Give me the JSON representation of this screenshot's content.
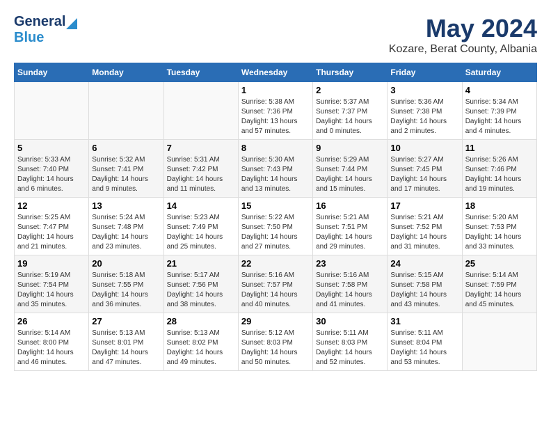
{
  "header": {
    "logo_general": "General",
    "logo_blue": "Blue",
    "month_title": "May 2024",
    "location": "Kozare, Berat County, Albania"
  },
  "days_of_week": [
    "Sunday",
    "Monday",
    "Tuesday",
    "Wednesday",
    "Thursday",
    "Friday",
    "Saturday"
  ],
  "weeks": [
    [
      {
        "date": "",
        "sunrise": "",
        "sunset": "",
        "daylight": ""
      },
      {
        "date": "",
        "sunrise": "",
        "sunset": "",
        "daylight": ""
      },
      {
        "date": "",
        "sunrise": "",
        "sunset": "",
        "daylight": ""
      },
      {
        "date": "1",
        "sunrise": "Sunrise: 5:38 AM",
        "sunset": "Sunset: 7:36 PM",
        "daylight": "Daylight: 13 hours and 57 minutes."
      },
      {
        "date": "2",
        "sunrise": "Sunrise: 5:37 AM",
        "sunset": "Sunset: 7:37 PM",
        "daylight": "Daylight: 14 hours and 0 minutes."
      },
      {
        "date": "3",
        "sunrise": "Sunrise: 5:36 AM",
        "sunset": "Sunset: 7:38 PM",
        "daylight": "Daylight: 14 hours and 2 minutes."
      },
      {
        "date": "4",
        "sunrise": "Sunrise: 5:34 AM",
        "sunset": "Sunset: 7:39 PM",
        "daylight": "Daylight: 14 hours and 4 minutes."
      }
    ],
    [
      {
        "date": "5",
        "sunrise": "Sunrise: 5:33 AM",
        "sunset": "Sunset: 7:40 PM",
        "daylight": "Daylight: 14 hours and 6 minutes."
      },
      {
        "date": "6",
        "sunrise": "Sunrise: 5:32 AM",
        "sunset": "Sunset: 7:41 PM",
        "daylight": "Daylight: 14 hours and 9 minutes."
      },
      {
        "date": "7",
        "sunrise": "Sunrise: 5:31 AM",
        "sunset": "Sunset: 7:42 PM",
        "daylight": "Daylight: 14 hours and 11 minutes."
      },
      {
        "date": "8",
        "sunrise": "Sunrise: 5:30 AM",
        "sunset": "Sunset: 7:43 PM",
        "daylight": "Daylight: 14 hours and 13 minutes."
      },
      {
        "date": "9",
        "sunrise": "Sunrise: 5:29 AM",
        "sunset": "Sunset: 7:44 PM",
        "daylight": "Daylight: 14 hours and 15 minutes."
      },
      {
        "date": "10",
        "sunrise": "Sunrise: 5:27 AM",
        "sunset": "Sunset: 7:45 PM",
        "daylight": "Daylight: 14 hours and 17 minutes."
      },
      {
        "date": "11",
        "sunrise": "Sunrise: 5:26 AM",
        "sunset": "Sunset: 7:46 PM",
        "daylight": "Daylight: 14 hours and 19 minutes."
      }
    ],
    [
      {
        "date": "12",
        "sunrise": "Sunrise: 5:25 AM",
        "sunset": "Sunset: 7:47 PM",
        "daylight": "Daylight: 14 hours and 21 minutes."
      },
      {
        "date": "13",
        "sunrise": "Sunrise: 5:24 AM",
        "sunset": "Sunset: 7:48 PM",
        "daylight": "Daylight: 14 hours and 23 minutes."
      },
      {
        "date": "14",
        "sunrise": "Sunrise: 5:23 AM",
        "sunset": "Sunset: 7:49 PM",
        "daylight": "Daylight: 14 hours and 25 minutes."
      },
      {
        "date": "15",
        "sunrise": "Sunrise: 5:22 AM",
        "sunset": "Sunset: 7:50 PM",
        "daylight": "Daylight: 14 hours and 27 minutes."
      },
      {
        "date": "16",
        "sunrise": "Sunrise: 5:21 AM",
        "sunset": "Sunset: 7:51 PM",
        "daylight": "Daylight: 14 hours and 29 minutes."
      },
      {
        "date": "17",
        "sunrise": "Sunrise: 5:21 AM",
        "sunset": "Sunset: 7:52 PM",
        "daylight": "Daylight: 14 hours and 31 minutes."
      },
      {
        "date": "18",
        "sunrise": "Sunrise: 5:20 AM",
        "sunset": "Sunset: 7:53 PM",
        "daylight": "Daylight: 14 hours and 33 minutes."
      }
    ],
    [
      {
        "date": "19",
        "sunrise": "Sunrise: 5:19 AM",
        "sunset": "Sunset: 7:54 PM",
        "daylight": "Daylight: 14 hours and 35 minutes."
      },
      {
        "date": "20",
        "sunrise": "Sunrise: 5:18 AM",
        "sunset": "Sunset: 7:55 PM",
        "daylight": "Daylight: 14 hours and 36 minutes."
      },
      {
        "date": "21",
        "sunrise": "Sunrise: 5:17 AM",
        "sunset": "Sunset: 7:56 PM",
        "daylight": "Daylight: 14 hours and 38 minutes."
      },
      {
        "date": "22",
        "sunrise": "Sunrise: 5:16 AM",
        "sunset": "Sunset: 7:57 PM",
        "daylight": "Daylight: 14 hours and 40 minutes."
      },
      {
        "date": "23",
        "sunrise": "Sunrise: 5:16 AM",
        "sunset": "Sunset: 7:58 PM",
        "daylight": "Daylight: 14 hours and 41 minutes."
      },
      {
        "date": "24",
        "sunrise": "Sunrise: 5:15 AM",
        "sunset": "Sunset: 7:58 PM",
        "daylight": "Daylight: 14 hours and 43 minutes."
      },
      {
        "date": "25",
        "sunrise": "Sunrise: 5:14 AM",
        "sunset": "Sunset: 7:59 PM",
        "daylight": "Daylight: 14 hours and 45 minutes."
      }
    ],
    [
      {
        "date": "26",
        "sunrise": "Sunrise: 5:14 AM",
        "sunset": "Sunset: 8:00 PM",
        "daylight": "Daylight: 14 hours and 46 minutes."
      },
      {
        "date": "27",
        "sunrise": "Sunrise: 5:13 AM",
        "sunset": "Sunset: 8:01 PM",
        "daylight": "Daylight: 14 hours and 47 minutes."
      },
      {
        "date": "28",
        "sunrise": "Sunrise: 5:13 AM",
        "sunset": "Sunset: 8:02 PM",
        "daylight": "Daylight: 14 hours and 49 minutes."
      },
      {
        "date": "29",
        "sunrise": "Sunrise: 5:12 AM",
        "sunset": "Sunset: 8:03 PM",
        "daylight": "Daylight: 14 hours and 50 minutes."
      },
      {
        "date": "30",
        "sunrise": "Sunrise: 5:11 AM",
        "sunset": "Sunset: 8:03 PM",
        "daylight": "Daylight: 14 hours and 52 minutes."
      },
      {
        "date": "31",
        "sunrise": "Sunrise: 5:11 AM",
        "sunset": "Sunset: 8:04 PM",
        "daylight": "Daylight: 14 hours and 53 minutes."
      },
      {
        "date": "",
        "sunrise": "",
        "sunset": "",
        "daylight": ""
      }
    ]
  ]
}
